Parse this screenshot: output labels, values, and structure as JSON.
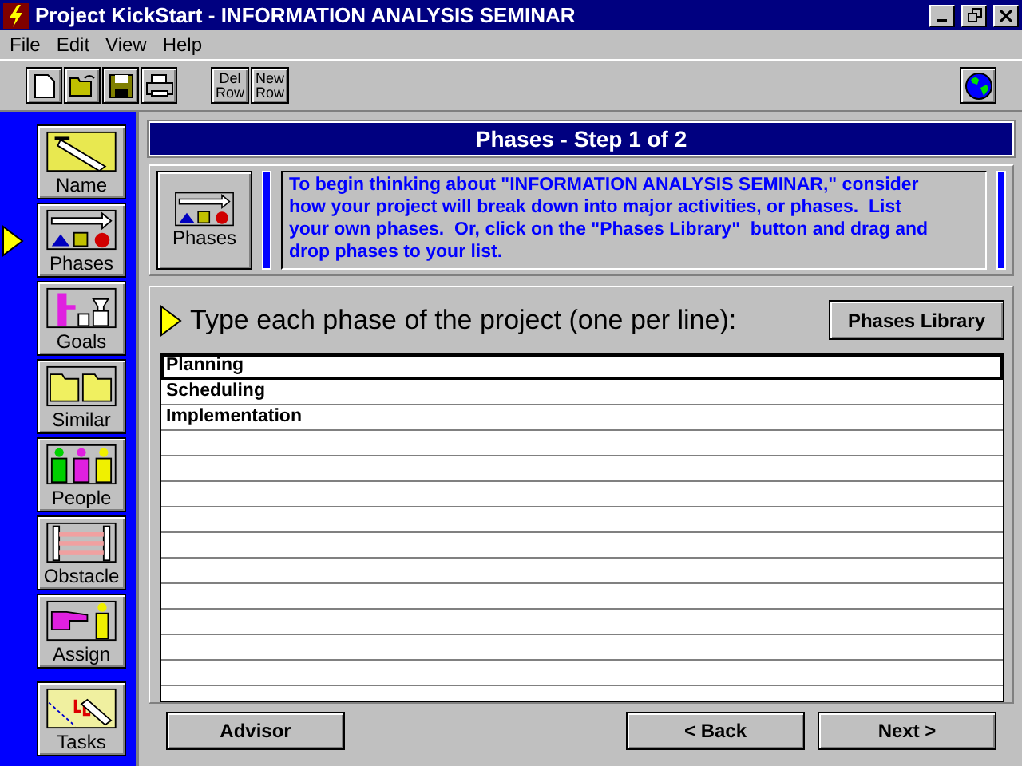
{
  "window": {
    "title": "Project KickStart - INFORMATION ANALYSIS SEMINAR"
  },
  "menu": [
    "File",
    "Edit",
    "View",
    "Help"
  ],
  "toolbar": {
    "row_buttons": [
      "Del Row",
      "New Row"
    ]
  },
  "sidebar": {
    "items": [
      {
        "label": "Name",
        "selected": false
      },
      {
        "label": "Phases",
        "selected": true
      },
      {
        "label": "Goals",
        "selected": false
      },
      {
        "label": "Similar",
        "selected": false
      },
      {
        "label": "People",
        "selected": false
      },
      {
        "label": "Obstacle",
        "selected": false
      },
      {
        "label": "Assign",
        "selected": false
      },
      {
        "label": "Tasks",
        "selected": false
      }
    ]
  },
  "header": "Phases - Step 1 of 2",
  "intro": {
    "icon_label": "Phases",
    "text": "To begin thinking about \"INFORMATION ANALYSIS SEMINAR,\" consider how your project will break down into major activities, or phases.  List your own phases.  Or, click on the \"Phases Library\"  button and drag and drop phases to your list."
  },
  "prompt": "Type each phase of the project (one per line):",
  "library_button": "Phases Library",
  "phases": [
    {
      "value": "Planning",
      "selected": true
    },
    {
      "value": "Scheduling",
      "selected": false
    },
    {
      "value": "Implementation",
      "selected": false
    }
  ],
  "buttons": {
    "advisor": "Advisor",
    "back": "< Back",
    "next": "Next >"
  }
}
